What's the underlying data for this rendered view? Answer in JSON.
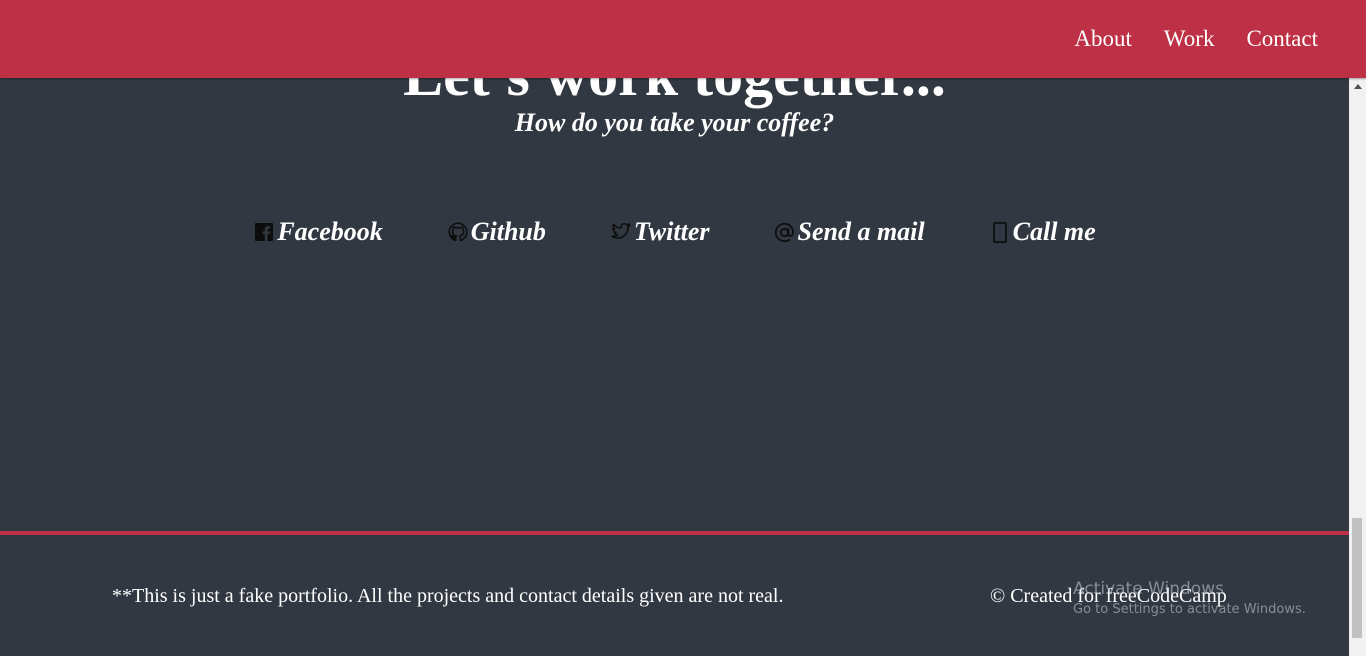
{
  "nav": {
    "items": [
      {
        "label": "About"
      },
      {
        "label": "Work"
      },
      {
        "label": "Contact"
      }
    ]
  },
  "contact": {
    "heading": "Let's work together...",
    "subheading": "How do you take your coffee?",
    "links": [
      {
        "label": "Facebook",
        "icon": "facebook-icon"
      },
      {
        "label": "Github",
        "icon": "github-icon"
      },
      {
        "label": "Twitter",
        "icon": "twitter-icon"
      },
      {
        "label": "Send a mail",
        "icon": "at-icon"
      },
      {
        "label": "Call me",
        "icon": "phone-icon"
      }
    ]
  },
  "footer": {
    "note": "**This is just a fake portfolio. All the projects and contact details given are not real.",
    "credit": "© Created for freeCodeCamp"
  },
  "watermark": {
    "title": "Activate Windows",
    "subtitle": "Go to Settings to activate Windows."
  },
  "colors": {
    "accent": "#be3045",
    "background": "#323842",
    "text": "#ffffff"
  }
}
